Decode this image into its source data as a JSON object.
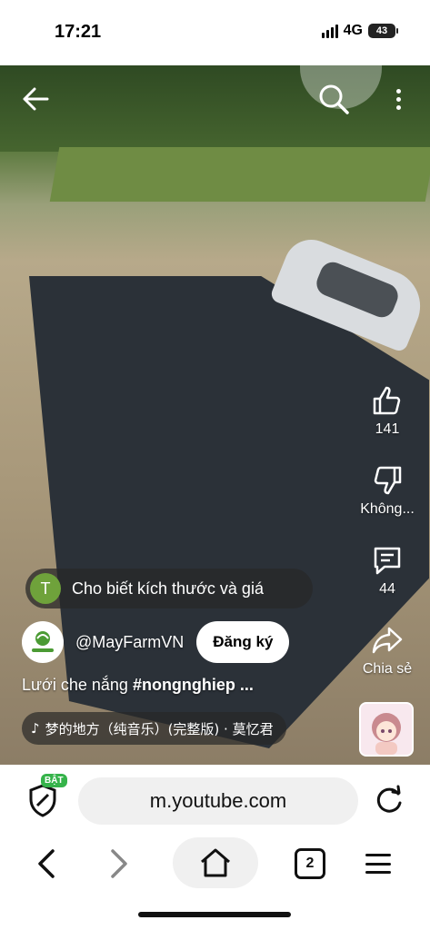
{
  "status_bar": {
    "time": "17:21",
    "network": "4G",
    "battery": "43"
  },
  "video": {
    "likes_count": "141",
    "dislike_label": "Không...",
    "comments_count": "44",
    "share_label": "Chia sẻ",
    "top_comment": {
      "avatar_letter": "T",
      "avatar_color": "#6fa23b",
      "text": "Cho biết kích thước và giá"
    },
    "channel": {
      "name": "@MayFarmVN",
      "subscribe_label": "Đăng ký"
    },
    "title": "Lưới che nắng ",
    "hashtag": "#nongnghiep ...",
    "music": "梦的地方（纯音乐）(完整版) · 莫忆君"
  },
  "browser": {
    "badge_label": "BẬT",
    "badge_color": "#35b34a",
    "url": "m.youtube.com",
    "tabs_count": "2"
  },
  "icons": [
    "back-arrow-icon",
    "search-icon",
    "more-vertical-icon",
    "like-icon",
    "dislike-icon",
    "comment-icon",
    "share-icon",
    "music-note-icon",
    "shield-icon",
    "reload-icon",
    "chevron-left-icon",
    "chevron-right-icon",
    "home-icon",
    "menu-icon"
  ]
}
